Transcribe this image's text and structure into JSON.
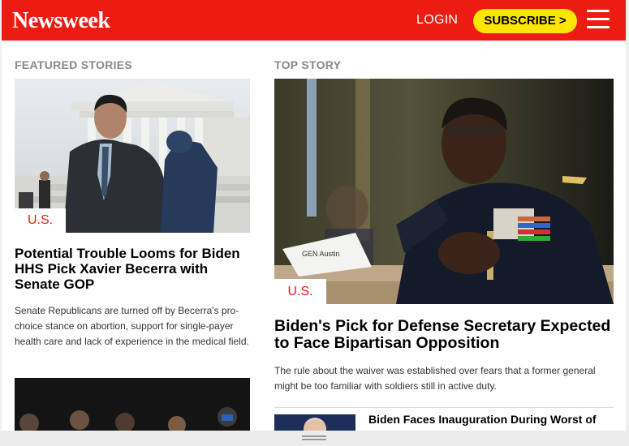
{
  "header": {
    "logo": "Newsweek",
    "login_label": "LOGIN",
    "subscribe_label": "SUBSCRIBE >",
    "menu_icon": "hamburger-menu-icon",
    "bg_color": "#ed1c12",
    "subscribe_color": "#fce500"
  },
  "featured": {
    "label": "FEATURED STORIES",
    "story": {
      "category": "U.S.",
      "headline": "Potential Trouble Looms for Biden HHS Pick Xavier Becerra with Senate GOP",
      "summary": "Senate Republicans are turned off by Becerra's pro-choice stance on abortion, support for single-payer health care and lack of experience in the medical field."
    }
  },
  "top_story": {
    "label": "TOP STORY",
    "story": {
      "category": "U.S.",
      "headline": "Biden's Pick for Defense Secretary Expected to Face Bipartisan Opposition",
      "summary": "The rule about the waiver was established over fears that a former general might be too familiar with soldiers still in active duty."
    },
    "secondary_headline": "Biden Faces Inauguration During Worst of"
  }
}
